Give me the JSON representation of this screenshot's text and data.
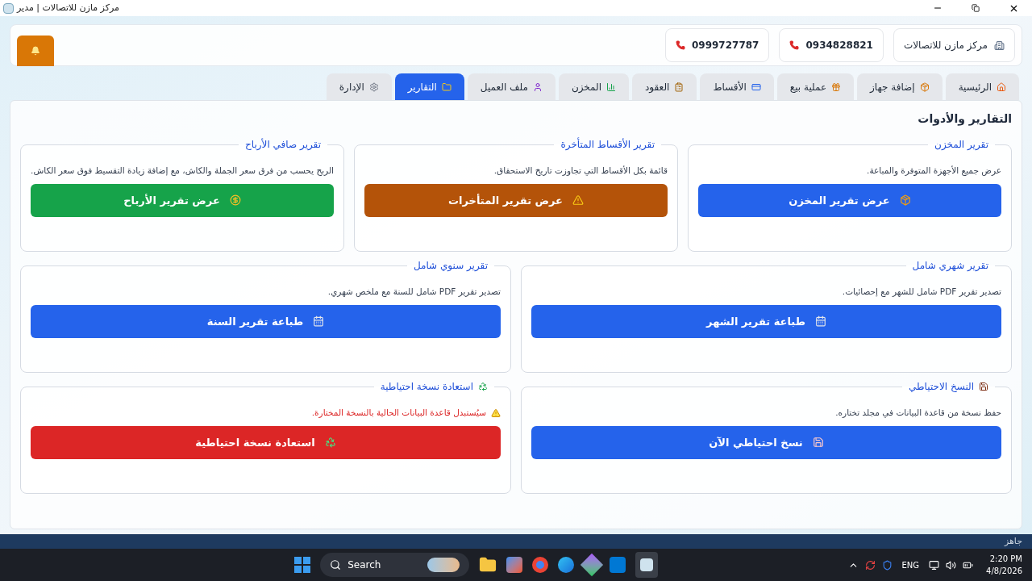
{
  "window": {
    "title": "مركز مازن للاتصالات | مدير"
  },
  "header": {
    "company": "مركز مازن للاتصالات",
    "phones": [
      "0934828821",
      "0999727787"
    ]
  },
  "tabs": [
    {
      "label": "الرئيسية",
      "selected": false
    },
    {
      "label": "إضافة جهاز",
      "selected": false
    },
    {
      "label": "عملية بيع",
      "selected": false
    },
    {
      "label": "الأقساط",
      "selected": false
    },
    {
      "label": "العقود",
      "selected": false
    },
    {
      "label": "المخزن",
      "selected": false
    },
    {
      "label": "ملف العميل",
      "selected": false
    },
    {
      "label": "التقارير",
      "selected": true
    },
    {
      "label": "الإدارة",
      "selected": false
    }
  ],
  "panel_title": "التقارير والأدوات",
  "rows": [
    [
      {
        "title": "تقرير المخزن",
        "description": "عرض جميع الأجهزة المتوفرة والمباعة.",
        "warning": false,
        "button": {
          "label": "عرض تقرير المخزن",
          "color": "#2563eb"
        }
      },
      {
        "title": "تقرير الأقساط المتأخرة",
        "description": "قائمة بكل الأقساط التي تجاوزت تاريخ الاستحقاق.",
        "warning": false,
        "button": {
          "label": "عرض تقرير المتأخرات",
          "color": "#b45309"
        }
      },
      {
        "title": "تقرير صافي الأرباح",
        "description": "الربح يحسب من فرق سعر الجملة والكاش، مع إضافة زيادة التقسيط فوق سعر الكاش.",
        "warning": false,
        "button": {
          "label": "عرض تقرير الأرباح",
          "color": "#16a34a"
        }
      }
    ],
    [
      {
        "title": "تقرير شهري شامل",
        "description": "تصدير تقرير PDF شامل للشهر مع إحصائيات.",
        "warning": false,
        "button": {
          "label": "طباعة تقرير الشهر",
          "color": "#2563eb"
        }
      },
      {
        "title": "تقرير سنوي شامل",
        "description": "تصدير تقرير PDF شامل للسنة مع ملخص شهري.",
        "warning": false,
        "button": {
          "label": "طباعة تقرير السنة",
          "color": "#2563eb"
        }
      }
    ],
    [
      {
        "title": "النسخ الاحتياطي",
        "description": "حفظ نسخة من قاعدة البيانات في مجلد تختاره.",
        "warning": false,
        "button": {
          "label": "نسخ احتياطي الآن",
          "color": "#2563eb"
        }
      },
      {
        "title": "استعادة نسخة احتياطية",
        "description": "سيُستبدل قاعدة البيانات الحالية بالنسخة المختارة.",
        "warning": true,
        "button": {
          "label": "استعادة نسخة احتياطية",
          "color": "#dc2626"
        }
      }
    ]
  ],
  "status_bar": "جاهز",
  "taskbar": {
    "search": "Search",
    "language": "ENG",
    "time": "2:20 PM",
    "date": "4/8/2026"
  }
}
